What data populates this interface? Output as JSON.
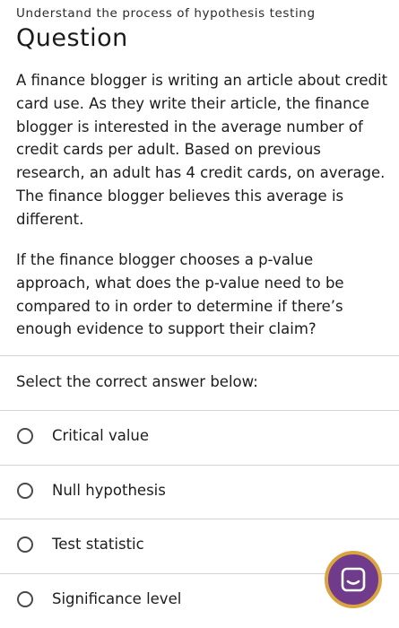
{
  "header": {
    "topic": "Understand the process of hypothesis testing",
    "title": "Question"
  },
  "question": {
    "paragraph1": "A finance blogger is writing an article about credit card use. As they write their article, the finance blogger is interested in the average number of credit cards per adult. Based on previous research, an adult has 4 credit cards, on average. The finance blogger believes this average is different.",
    "paragraph2": "If the finance blogger chooses a p-value approach, what does the p-value need to be compared to in order to determine if there’s enough evidence to support their claim?",
    "prompt": "Select the correct answer below:"
  },
  "options": [
    {
      "label": "Critical value"
    },
    {
      "label": "Null hypothesis"
    },
    {
      "label": "Test statistic"
    },
    {
      "label": "Significance level"
    }
  ],
  "chat_button": {
    "icon": "chat-bubble-icon",
    "colors": {
      "fill": "#6f3b8a",
      "ring": "#d9a441"
    }
  }
}
